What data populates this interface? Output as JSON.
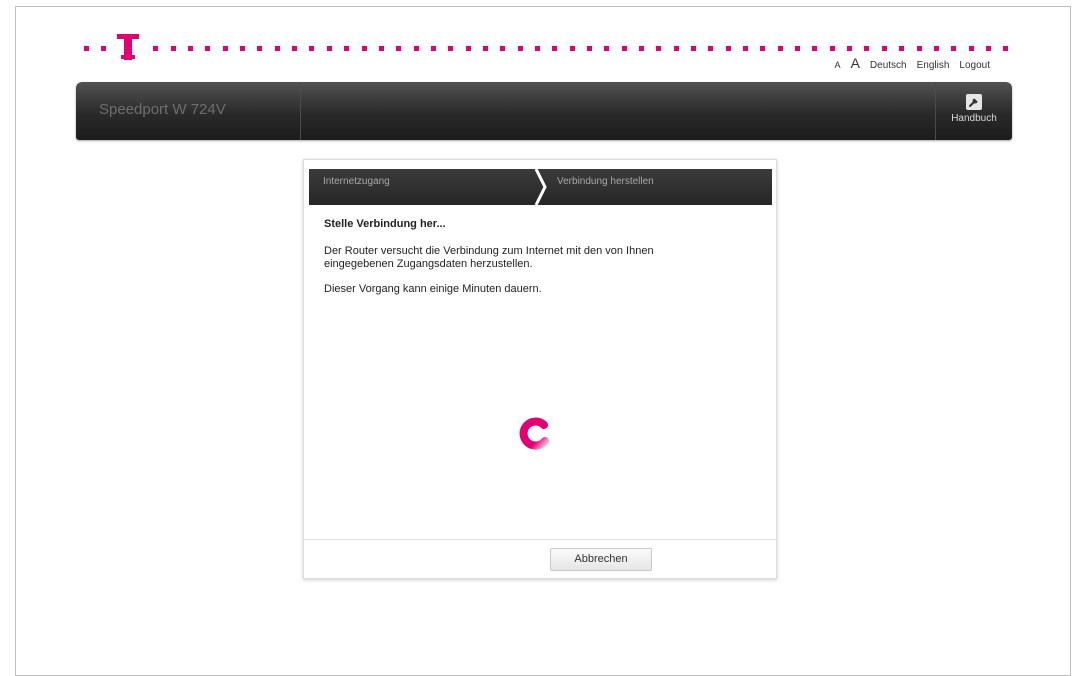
{
  "top_links": {
    "font_small": "A",
    "font_large": "A",
    "lang_de": "Deutsch",
    "lang_en": "English",
    "logout": "Logout"
  },
  "header": {
    "product_name": "Speedport W 724V",
    "handbuch_label": "Handbuch",
    "handbuch_icon": "wrench-icon"
  },
  "dialog": {
    "steps": [
      "Internetzugang",
      "Verbindung herstellen"
    ],
    "title": "Stelle Verbindung her...",
    "text_1": "Der Router versucht die Verbindung zum Internet mit den von Ihnen eingegebenen Zugangsdaten herzustellen.",
    "text_2": "Dieser Vorgang kann einige Minuten dauern.",
    "cancel_label": "Abbrechen",
    "spinner_icon": "loading-spinner-icon"
  },
  "colors": {
    "brand_magenta": "#e20074",
    "header_dark": "#2a2a2a"
  }
}
